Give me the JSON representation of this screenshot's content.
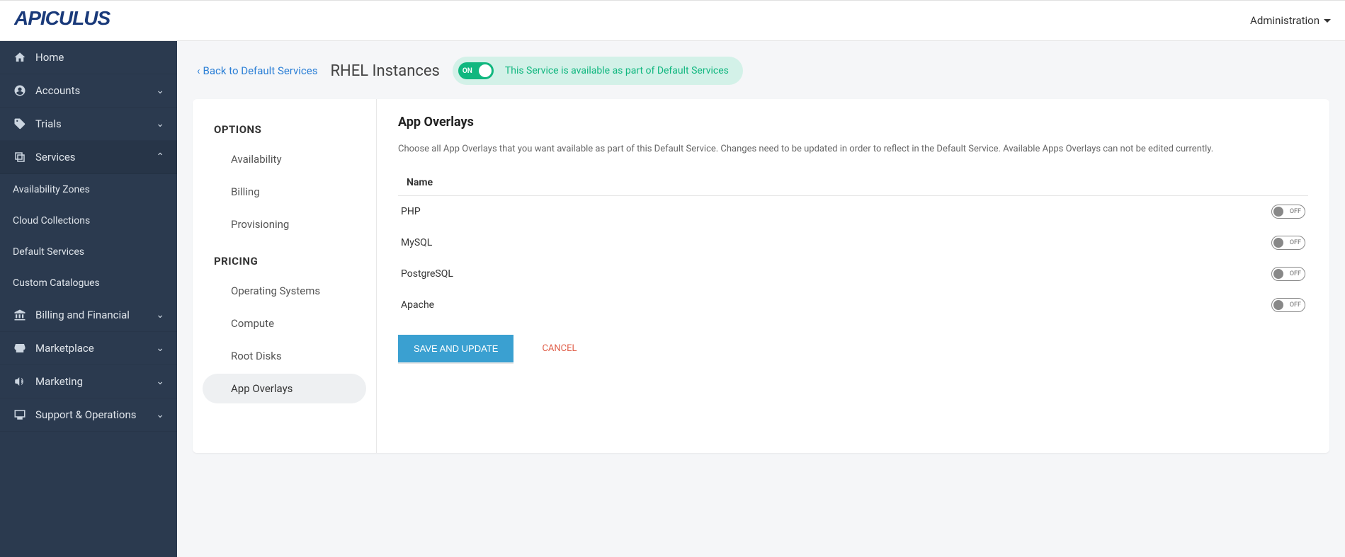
{
  "topbar": {
    "admin_label": "Administration"
  },
  "sidebar": {
    "home": "Home",
    "accounts": "Accounts",
    "trials": "Trials",
    "services": "Services",
    "services_sub": {
      "availability_zones": "Availability Zones",
      "cloud_collections": "Cloud Collections",
      "default_services": "Default Services",
      "custom_catalogues": "Custom Catalogues"
    },
    "billing_financial": "Billing and Financial",
    "marketplace": "Marketplace",
    "marketing": "Marketing",
    "support_ops": "Support & Operations"
  },
  "header": {
    "back_label": "Back to Default Services",
    "page_title": "RHEL Instances",
    "toggle_state": "ON",
    "status_text": "This Service is available as part of Default Services"
  },
  "options": {
    "header_options": "OPTIONS",
    "availability": "Availability",
    "billing": "Billing",
    "provisioning": "Provisioning",
    "header_pricing": "PRICING",
    "operating_systems": "Operating Systems",
    "compute": "Compute",
    "root_disks": "Root Disks",
    "app_overlays": "App Overlays"
  },
  "detail": {
    "title": "App Overlays",
    "description": "Choose all App Overlays that you want available as part of this Default Service. Changes need to be updated in order to reflect in the Default Service. Available Apps Overlays can not be edited currently.",
    "col_name": "Name",
    "rows": [
      {
        "name": "PHP",
        "state": "OFF"
      },
      {
        "name": "MySQL",
        "state": "OFF"
      },
      {
        "name": "PostgreSQL",
        "state": "OFF"
      },
      {
        "name": "Apache",
        "state": "OFF"
      }
    ],
    "save_label": "SAVE AND UPDATE",
    "cancel_label": "CANCEL"
  }
}
